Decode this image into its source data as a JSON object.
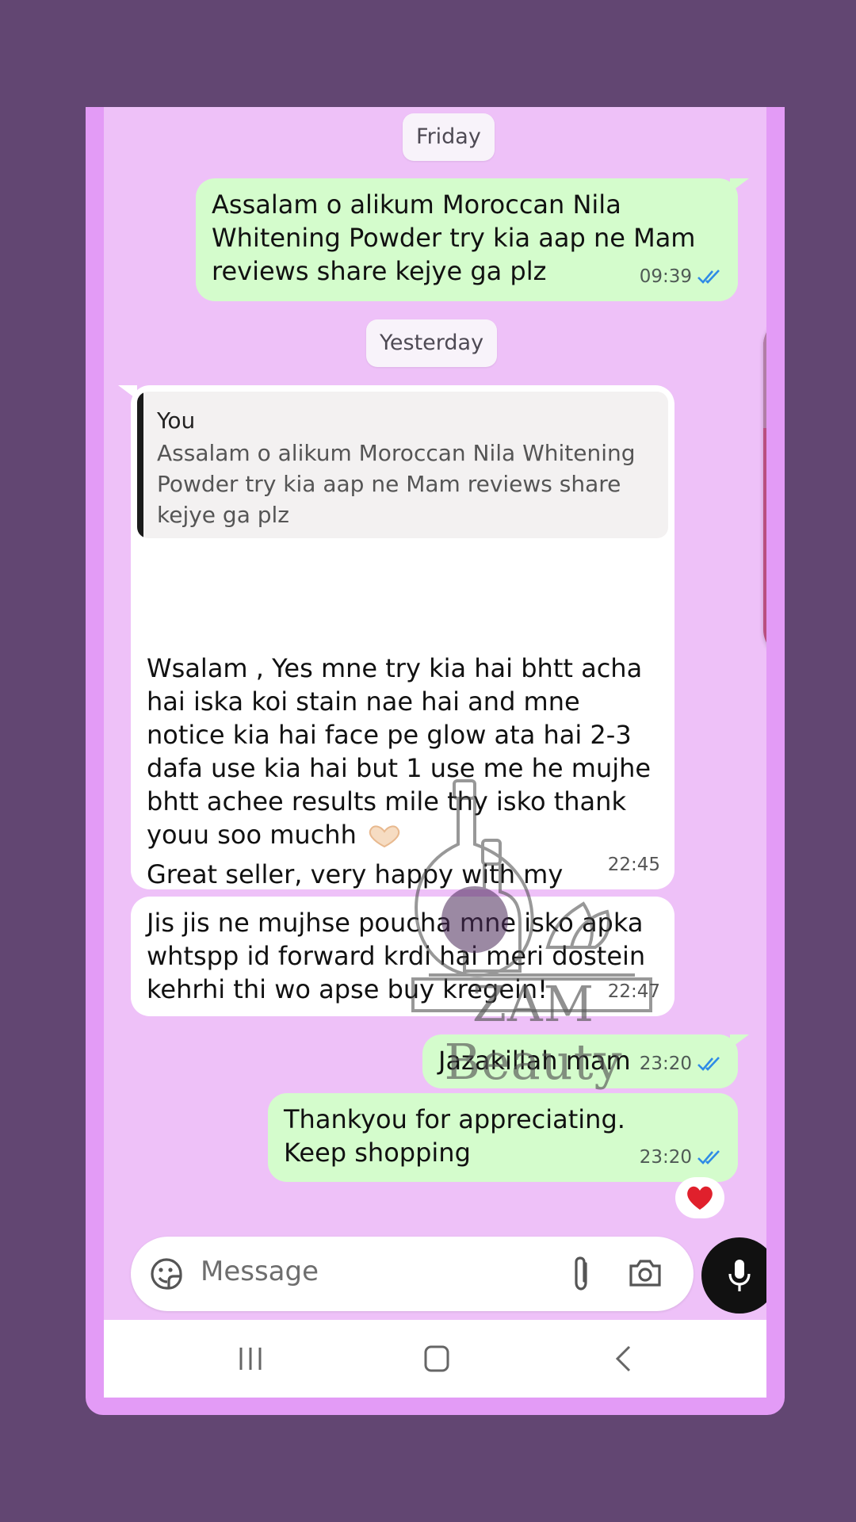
{
  "chat": {
    "date_friday": "Friday",
    "date_yesterday": "Yesterday",
    "messages": [
      {
        "direction": "outgoing",
        "text": "Assalam o alikum Moroccan Nila Whitening Powder try kia aap ne Mam reviews share kejye ga plz",
        "time": "09:39",
        "status": "read"
      },
      {
        "direction": "incoming",
        "quote_author": "You",
        "quote_text": "Assalam o alikum Moroccan Nila Whitening Powder try kia aap ne Mam reviews share kejye ga plz",
        "text_part1": "Wsalam , Yes mne try kia hai bhtt acha hai iska koi stain nae hai and mne notice kia hai face pe glow ata hai 2-3 dafa use kia hai but 1 use me he mujhe bhtt achee results mile thy isko thank youu soo muchh",
        "text_part2": "Great seller, very happy with my purchase! Item exactly as described Highly recommend this seller!",
        "time": "22:45"
      },
      {
        "direction": "incoming",
        "text": "Jis jis ne mujhse poucha mne isko apka whtspp id forward krdi hai meri dostein kehrhi thi wo apse buy kregein!",
        "time": "22:47"
      },
      {
        "direction": "outgoing",
        "text": "Jazakillah mam",
        "time": "23:20",
        "status": "read"
      },
      {
        "direction": "outgoing",
        "text": "Thankyou for appreciating. Keep shopping",
        "time": "23:20",
        "status": "read",
        "reaction": "red-heart"
      }
    ]
  },
  "watermark": {
    "text": "ZAM Beauty"
  },
  "composer": {
    "placeholder": "Message"
  },
  "colors": {
    "background": "#624672",
    "chat_background": "#eec1f8",
    "outgoing_bubble": "#d4fccc",
    "incoming_bubble": "#ffffff",
    "read_tick": "#2f8be6",
    "scrollbar": "#b94f80"
  },
  "icons": {
    "composer": [
      "sticker-icon",
      "attach-icon",
      "camera-icon",
      "microphone-icon"
    ],
    "navigation": [
      "recent-apps-icon",
      "home-icon",
      "back-icon"
    ],
    "scrollbar": [
      "more-dots-icon",
      "audio-icon"
    ]
  }
}
